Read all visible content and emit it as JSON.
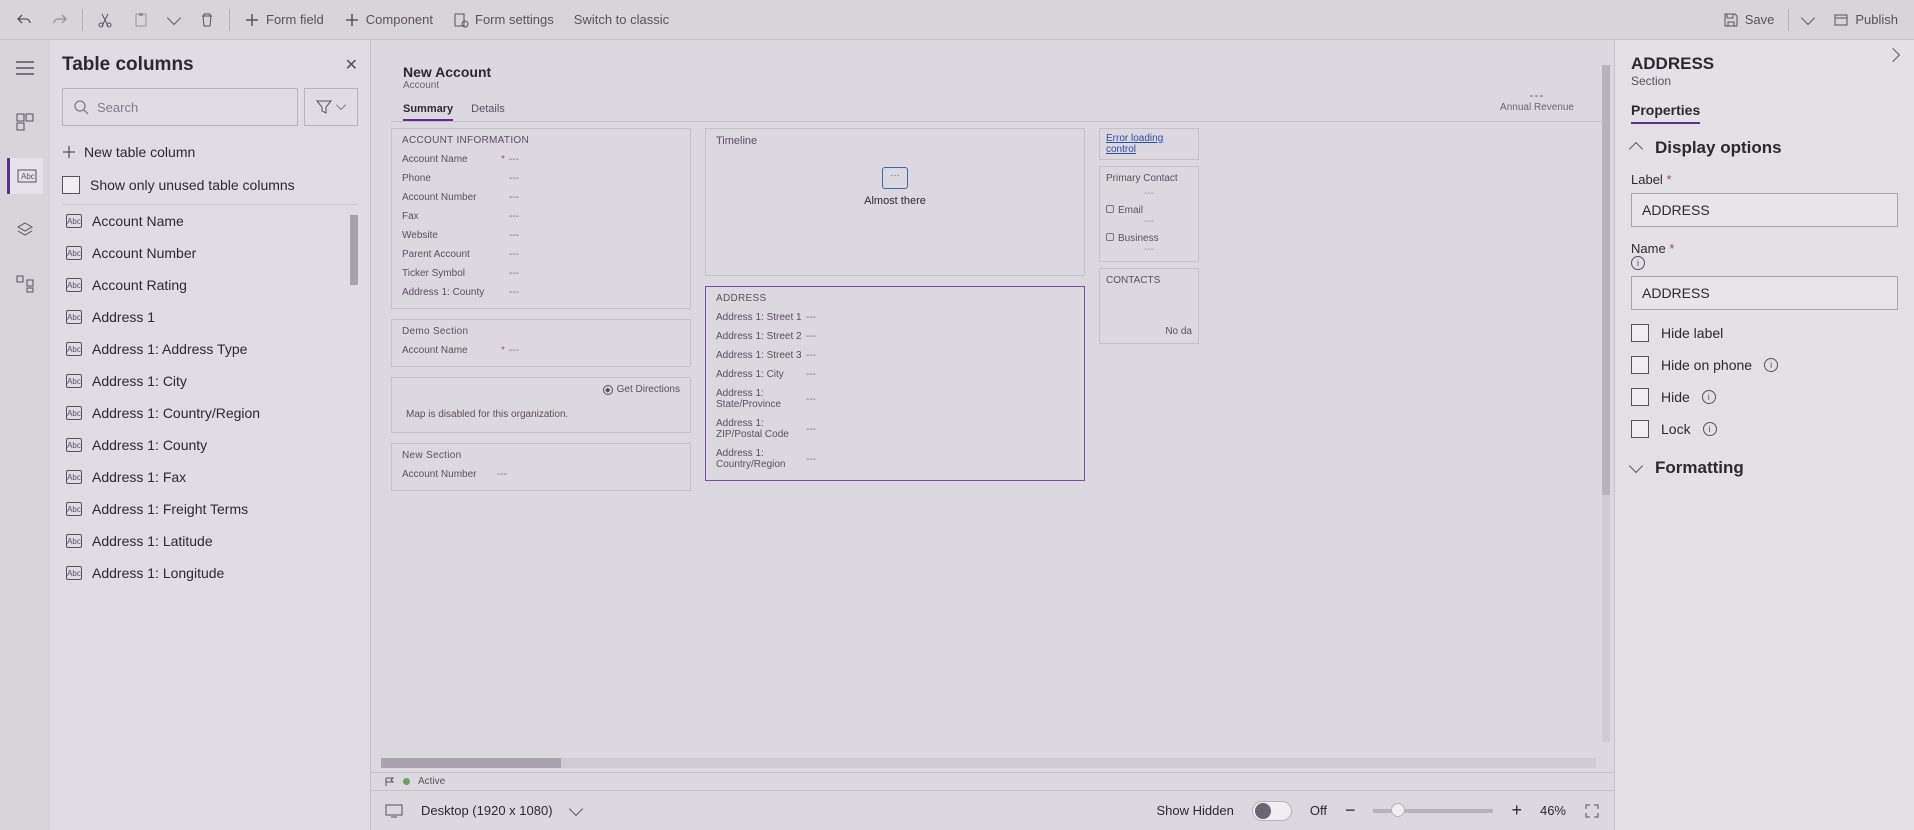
{
  "toolbar": {
    "form_field": "Form field",
    "component": "Component",
    "form_settings": "Form settings",
    "switch_classic": "Switch to classic",
    "save": "Save",
    "publish": "Publish"
  },
  "panel": {
    "title": "Table columns",
    "search_placeholder": "Search",
    "new_column": "New table column",
    "show_unused": "Show only unused table columns",
    "columns": [
      "Account Name",
      "Account Number",
      "Account Rating",
      "Address 1",
      "Address 1: Address Type",
      "Address 1: City",
      "Address 1: Country/Region",
      "Address 1: County",
      "Address 1: Fax",
      "Address 1: Freight Terms",
      "Address 1: Latitude",
      "Address 1: Longitude"
    ]
  },
  "canvas": {
    "form_title": "New Account",
    "entity": "Account",
    "tabs": [
      "Summary",
      "Details"
    ],
    "annual_revenue": "Annual Revenue",
    "sections": {
      "acct_info": {
        "title": "ACCOUNT INFORMATION",
        "rows": [
          "Account Name",
          "Phone",
          "Account Number",
          "Fax",
          "Website",
          "Parent Account",
          "Ticker Symbol",
          "Address 1: County"
        ]
      },
      "demo": {
        "title": "Demo Section",
        "rows": [
          "Account Name"
        ]
      },
      "map": {
        "get_directions": "Get Directions",
        "msg": "Map is disabled for this organization."
      },
      "new": {
        "title": "New Section",
        "rows": [
          "Account Number"
        ]
      },
      "timeline": {
        "title": "Timeline",
        "almost": "Almost there"
      },
      "address": {
        "title": "ADDRESS",
        "rows": [
          "Address 1: Street 1",
          "Address 1: Street 2",
          "Address 1: Street 3",
          "Address 1: City",
          "Address 1: State/Province",
          "Address 1: ZIP/Postal Code",
          "Address 1: Country/Region"
        ]
      },
      "side": {
        "error": "Error loading control",
        "primary_contact": "Primary Contact",
        "email": "Email",
        "business": "Business",
        "contacts": "CONTACTS",
        "nodata": "No da"
      }
    },
    "status": "Active"
  },
  "bottombar": {
    "viewport": "Desktop (1920 x 1080)",
    "show_hidden": "Show Hidden",
    "hidden_state": "Off",
    "zoom": "46%"
  },
  "props": {
    "title": "ADDRESS",
    "subtitle": "Section",
    "tab": "Properties",
    "group_display": "Display options",
    "label_field": "Label",
    "label_value": "ADDRESS",
    "name_field": "Name",
    "name_value": "ADDRESS",
    "hide_label": "Hide label",
    "hide_phone": "Hide on phone",
    "hide": "Hide",
    "lock": "Lock",
    "group_formatting": "Formatting"
  }
}
